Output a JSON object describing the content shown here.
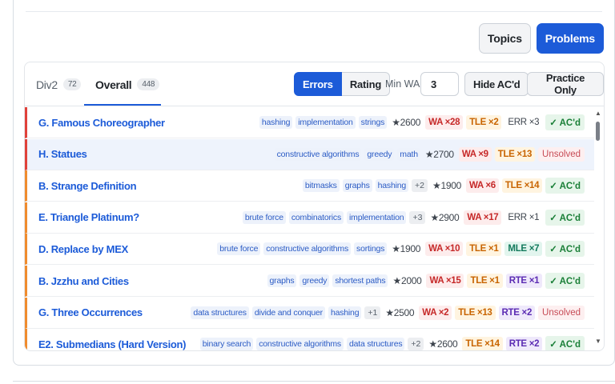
{
  "header": {
    "topics_label": "Topics",
    "problems_label": "Problems"
  },
  "tabs": [
    {
      "label": "Div2",
      "count": "72"
    },
    {
      "label": "Overall",
      "count": "448"
    }
  ],
  "toolbar": {
    "errors_label": "Errors",
    "rating_label": "Rating",
    "minwa_label": "Min WA:",
    "minwa_value": "3",
    "hide_acd_label": "Hide AC'd",
    "practice_only_label": "Practice Only"
  },
  "problems": [
    {
      "name": "G. Famous Choreographer",
      "tags": [
        "hashing",
        "implementation",
        "strings"
      ],
      "more": "",
      "rating": "★2600",
      "badges": [
        {
          "kind": "wa",
          "text": "WA ×28"
        },
        {
          "kind": "tle",
          "text": "TLE ×2"
        },
        {
          "kind": "err",
          "text": "ERR ×3"
        }
      ],
      "status": {
        "kind": "acd",
        "text": "✓ AC'd"
      }
    },
    {
      "name": "H. Statues",
      "tags": [
        "constructive algorithms",
        "greedy",
        "math"
      ],
      "more": "",
      "rating": "★2700",
      "badges": [
        {
          "kind": "wa",
          "text": "WA ×9"
        },
        {
          "kind": "tle",
          "text": "TLE ×13"
        }
      ],
      "status": {
        "kind": "unsolved",
        "text": "Unsolved"
      }
    },
    {
      "name": "B. Strange Definition",
      "tags": [
        "bitmasks",
        "graphs",
        "hashing"
      ],
      "more": "+2",
      "rating": "★1900",
      "badges": [
        {
          "kind": "wa",
          "text": "WA ×6"
        },
        {
          "kind": "tle",
          "text": "TLE ×14"
        }
      ],
      "status": {
        "kind": "acd",
        "text": "✓ AC'd"
      }
    },
    {
      "name": "E. Triangle Platinum?",
      "tags": [
        "brute force",
        "combinatorics",
        "implementation"
      ],
      "more": "+3",
      "rating": "★2900",
      "badges": [
        {
          "kind": "wa",
          "text": "WA ×17"
        },
        {
          "kind": "err",
          "text": "ERR ×1"
        }
      ],
      "status": {
        "kind": "acd",
        "text": "✓ AC'd"
      }
    },
    {
      "name": "D. Replace by MEX",
      "tags": [
        "brute force",
        "constructive algorithms",
        "sortings"
      ],
      "more": "",
      "rating": "★1900",
      "badges": [
        {
          "kind": "wa",
          "text": "WA ×10"
        },
        {
          "kind": "tle",
          "text": "TLE ×1"
        },
        {
          "kind": "mle",
          "text": "MLE ×7"
        }
      ],
      "status": {
        "kind": "acd",
        "text": "✓ AC'd"
      }
    },
    {
      "name": "B. Jzzhu and Cities",
      "tags": [
        "graphs",
        "greedy",
        "shortest paths"
      ],
      "more": "",
      "rating": "★2000",
      "badges": [
        {
          "kind": "wa",
          "text": "WA ×15"
        },
        {
          "kind": "tle",
          "text": "TLE ×1"
        },
        {
          "kind": "rte",
          "text": "RTE ×1"
        }
      ],
      "status": {
        "kind": "acd",
        "text": "✓ AC'd"
      }
    },
    {
      "name": "G. Three Occurrences",
      "tags": [
        "data structures",
        "divide and conquer",
        "hashing"
      ],
      "more": "+1",
      "rating": "★2500",
      "badges": [
        {
          "kind": "wa",
          "text": "WA ×2"
        },
        {
          "kind": "tle",
          "text": "TLE ×13"
        },
        {
          "kind": "rte",
          "text": "RTE ×2"
        }
      ],
      "status": {
        "kind": "unsolved",
        "text": "Unsolved"
      }
    },
    {
      "name": "E2. Submedians (Hard Version)",
      "tags": [
        "binary search",
        "constructive algorithms",
        "data structures"
      ],
      "more": "+2",
      "rating": "★2600",
      "badges": [
        {
          "kind": "tle",
          "text": "TLE ×14"
        },
        {
          "kind": "rte",
          "text": "RTE ×2"
        }
      ],
      "status": {
        "kind": "acd",
        "text": "✓ AC'd"
      }
    }
  ],
  "scrollbar": {
    "up_icon": "▲",
    "down_icon": "▼"
  }
}
